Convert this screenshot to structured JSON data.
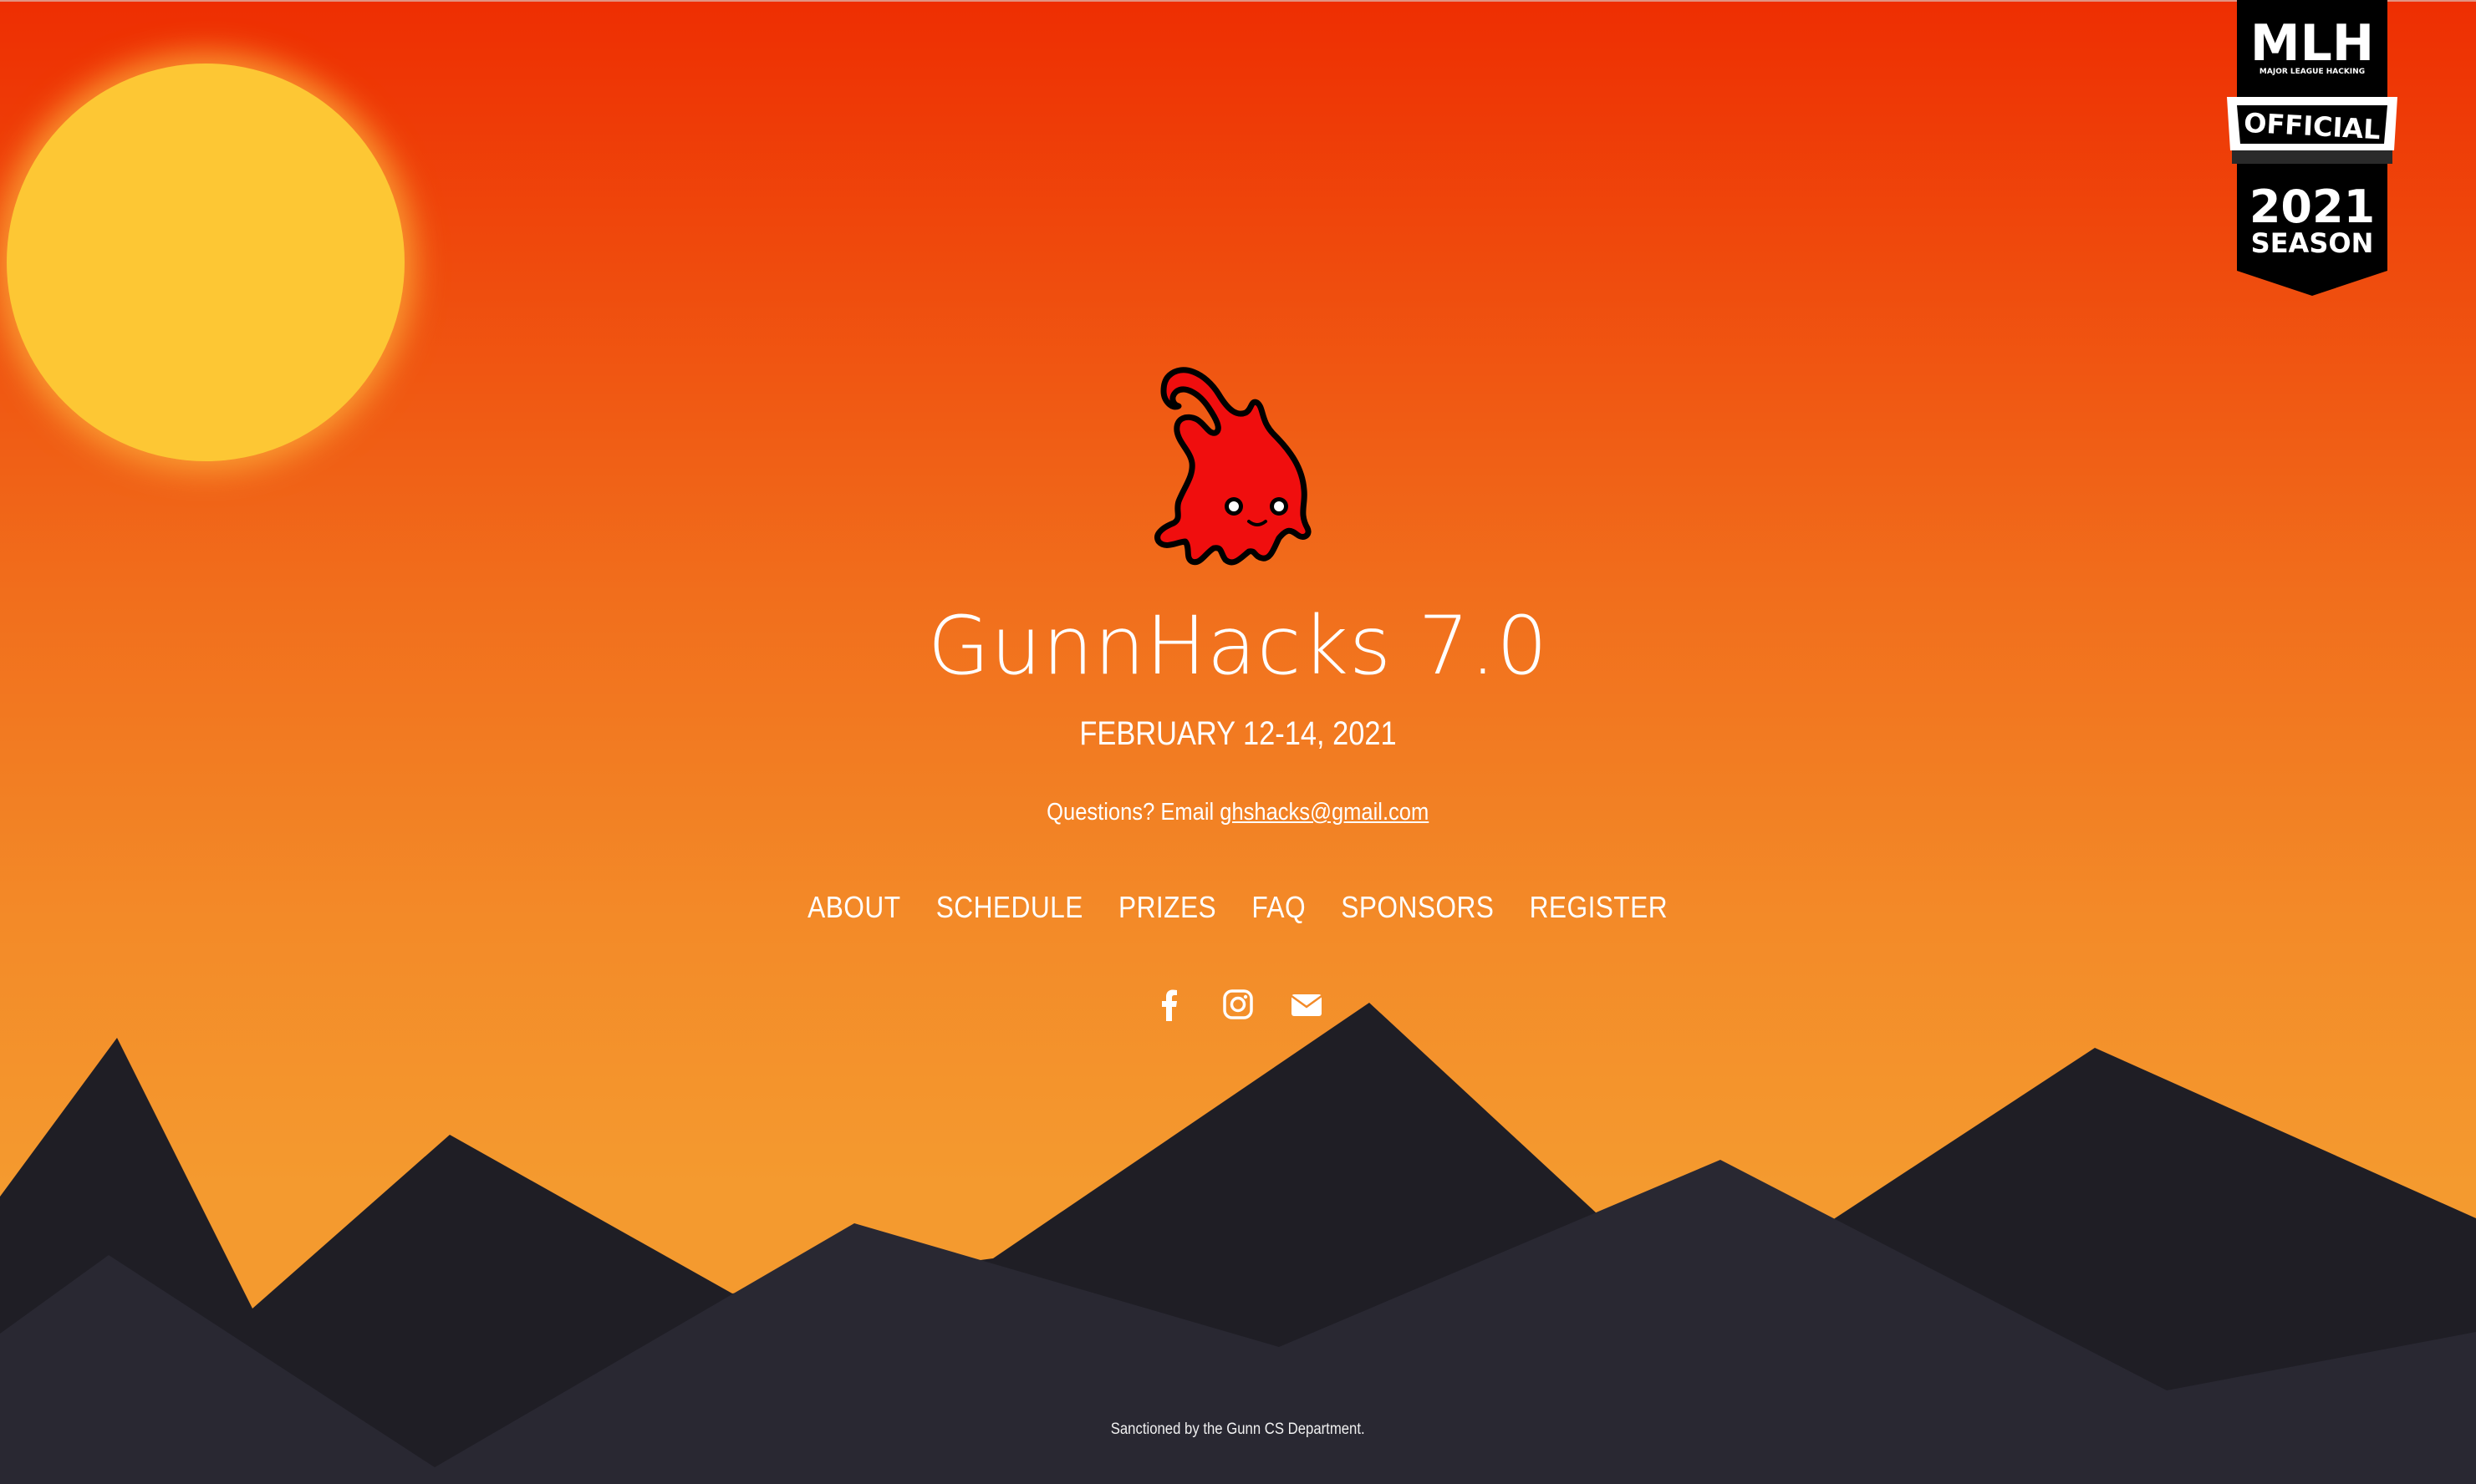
{
  "colors": {
    "sky_top": "#ee2e02",
    "sky_bottom": "#f49a2f",
    "sun": "#fdc734",
    "mountain_back": "#1f1e25",
    "mountain_front": "#292832",
    "badge": "#000000",
    "mascot": "#f00e0e"
  },
  "badge": {
    "line1": "MLH",
    "line2": "MAJOR LEAGUE HACKING",
    "line3": "OFFICIAL",
    "line4": "2021",
    "line5": "SEASON"
  },
  "hero": {
    "mascot_icon": "flame-mascot-icon",
    "title": "GunnHacks 7.0",
    "date": "FEBRUARY 12-14, 2021",
    "contact_prefix": "Questions? Email ",
    "contact_email": "ghshacks@gmail.com"
  },
  "nav": {
    "items": [
      {
        "label": "ABOUT"
      },
      {
        "label": "SCHEDULE"
      },
      {
        "label": "PRIZES"
      },
      {
        "label": "FAQ"
      },
      {
        "label": "SPONSORS"
      },
      {
        "label": "REGISTER"
      }
    ]
  },
  "socials": [
    {
      "icon": "facebook-icon"
    },
    {
      "icon": "instagram-icon"
    },
    {
      "icon": "envelope-icon"
    }
  ],
  "footer": {
    "text": "Sanctioned by the Gunn CS Department."
  }
}
